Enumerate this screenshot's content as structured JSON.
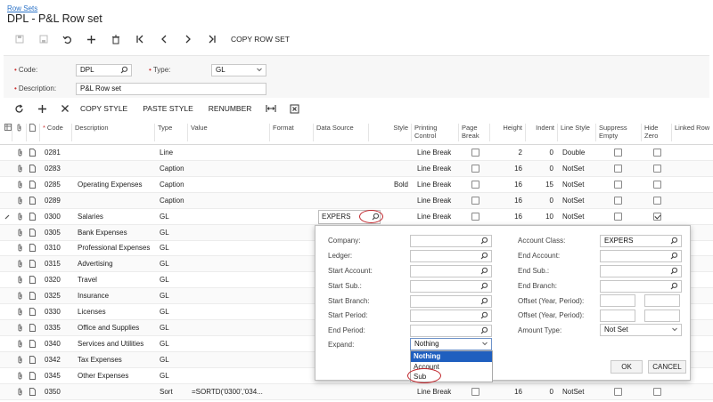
{
  "breadcrumb": "Row Sets",
  "page_title": "DPL - P&L Row set",
  "toolbar": {
    "copy_row_set": "COPY ROW SET"
  },
  "form": {
    "code_label": "Code:",
    "code_value": "DPL",
    "type_label": "Type:",
    "type_value": "GL",
    "description_label": "Description:",
    "description_value": "P&L Row set"
  },
  "grid_toolbar": {
    "copy_style": "COPY STYLE",
    "paste_style": "PASTE STYLE",
    "renumber": "RENUMBER"
  },
  "columns": {
    "code": "Code",
    "description": "Description",
    "type": "Type",
    "value": "Value",
    "format": "Format",
    "data_source": "Data Source",
    "style": "Style",
    "printing_control": "Printing Control",
    "page_break": "Page Break",
    "height": "Height",
    "indent": "Indent",
    "line_style": "Line Style",
    "suppress_empty": "Suppress Empty",
    "hide_zero": "Hide Zero",
    "linked_row": "Linked Row"
  },
  "rows": [
    {
      "code": "0281",
      "description": "",
      "type": "Line",
      "value": "",
      "data_source": "",
      "style": "",
      "printing": "Line Break",
      "height": "2",
      "indent": "0",
      "line_style": "Double",
      "hide_zero": false
    },
    {
      "code": "0283",
      "description": "",
      "type": "Caption",
      "value": "",
      "data_source": "",
      "style": "",
      "printing": "Line Break",
      "height": "16",
      "indent": "0",
      "line_style": "NotSet",
      "hide_zero": false
    },
    {
      "code": "0285",
      "description": "Operating Expenses",
      "type": "Caption",
      "value": "",
      "data_source": "",
      "style": "Bold",
      "printing": "Line Break",
      "height": "16",
      "indent": "15",
      "line_style": "NotSet",
      "hide_zero": false
    },
    {
      "code": "0289",
      "description": "",
      "type": "Caption",
      "value": "",
      "data_source": "",
      "style": "",
      "printing": "Line Break",
      "height": "16",
      "indent": "0",
      "line_style": "NotSet",
      "hide_zero": false
    },
    {
      "code": "0300",
      "description": "Salaries",
      "type": "GL",
      "value": "",
      "data_source": "EXPERS",
      "style": "",
      "printing": "Line Break",
      "height": "16",
      "indent": "10",
      "line_style": "NotSet",
      "hide_zero": true
    },
    {
      "code": "0305",
      "description": "Bank Expenses",
      "type": "GL"
    },
    {
      "code": "0310",
      "description": "Professional Expenses",
      "type": "GL"
    },
    {
      "code": "0315",
      "description": "Advertising",
      "type": "GL"
    },
    {
      "code": "0320",
      "description": "Travel",
      "type": "GL"
    },
    {
      "code": "0325",
      "description": "Insurance",
      "type": "GL"
    },
    {
      "code": "0330",
      "description": "Licenses",
      "type": "GL"
    },
    {
      "code": "0335",
      "description": "Office and Supplies",
      "type": "GL"
    },
    {
      "code": "0340",
      "description": "Services and Utilities",
      "type": "GL"
    },
    {
      "code": "0342",
      "description": "Tax Expenses",
      "type": "GL"
    },
    {
      "code": "0345",
      "description": "Other Expenses",
      "type": "GL"
    },
    {
      "code": "0350",
      "description": "",
      "type": "Sort",
      "value": "=SORTD('0300','034...",
      "data_source": "",
      "style": "",
      "printing": "Line Break",
      "height": "16",
      "indent": "0",
      "line_style": "NotSet",
      "hide_zero": false
    }
  ],
  "popup": {
    "company": "Company:",
    "ledger": "Ledger:",
    "start_account": "Start Account:",
    "start_sub": "Start Sub.:",
    "start_branch": "Start Branch:",
    "start_period": "Start Period:",
    "end_period": "End Period:",
    "expand": "Expand:",
    "expand_value": "Nothing",
    "account_class": "Account Class:",
    "account_class_value": "EXPERS",
    "end_account": "End Account:",
    "end_sub": "End Sub.:",
    "end_branch": "End Branch:",
    "offset_year_period_1": "Offset (Year, Period):",
    "offset_year_period_2": "Offset (Year, Period):",
    "amount_type": "Amount Type:",
    "amount_type_value": "Not Set",
    "ok": "OK",
    "cancel": "CANCEL"
  },
  "expand_options": [
    "Nothing",
    "Account",
    "Sub"
  ],
  "colors": {
    "link": "#2a72c7",
    "selected": "#1f5fbf",
    "annotation": "#c0262c"
  }
}
